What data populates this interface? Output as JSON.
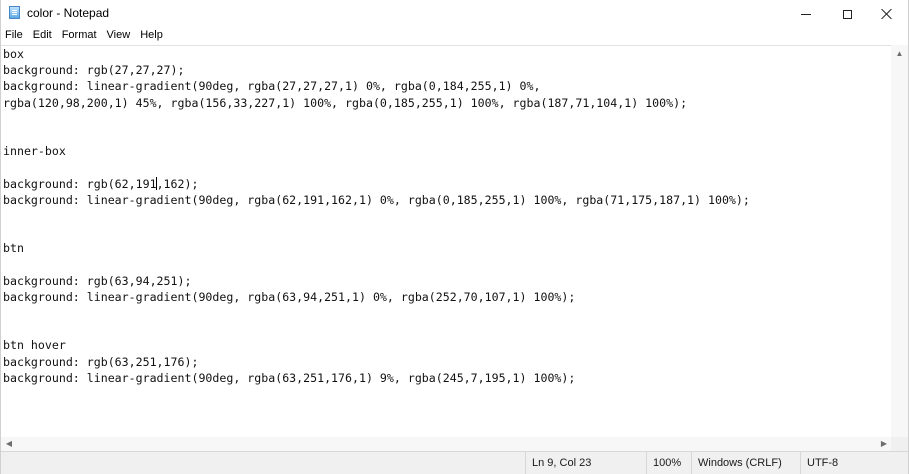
{
  "window": {
    "title": "color - Notepad",
    "icon": "notepad-icon",
    "controls": {
      "minimize": "minimize-icon",
      "maximize": "maximize-icon",
      "close": "close-icon"
    }
  },
  "menu": [
    "File",
    "Edit",
    "Format",
    "View",
    "Help"
  ],
  "editor": {
    "caret_line": 9,
    "caret_col": 23,
    "lines": [
      "box",
      "background: rgb(27,27,27);",
      "background: linear-gradient(90deg, rgba(27,27,27,1) 0%, rgba(0,184,255,1) 0%,",
      "rgba(120,98,200,1) 45%, rgba(156,33,227,1) 100%, rgba(0,185,255,1) 100%, rgba(187,71,104,1) 100%);",
      "",
      "",
      "inner-box",
      "",
      "background: rgb(62,191,162);",
      "background: linear-gradient(90deg, rgba(62,191,162,1) 0%, rgba(0,185,255,1) 100%, rgba(71,175,187,1) 100%);",
      "",
      "",
      "btn",
      "",
      "background: rgb(63,94,251);",
      "background: linear-gradient(90deg, rgba(63,94,251,1) 0%, rgba(252,70,107,1) 100%);",
      "",
      "",
      "btn hover",
      "background: rgb(63,251,176);",
      "background: linear-gradient(90deg, rgba(63,251,176,1) 9%, rgba(245,7,195,1) 100%);"
    ]
  },
  "status": {
    "position": "Ln 9, Col 23",
    "zoom": "100%",
    "line_endings": "Windows (CRLF)",
    "encoding": "UTF-8"
  }
}
